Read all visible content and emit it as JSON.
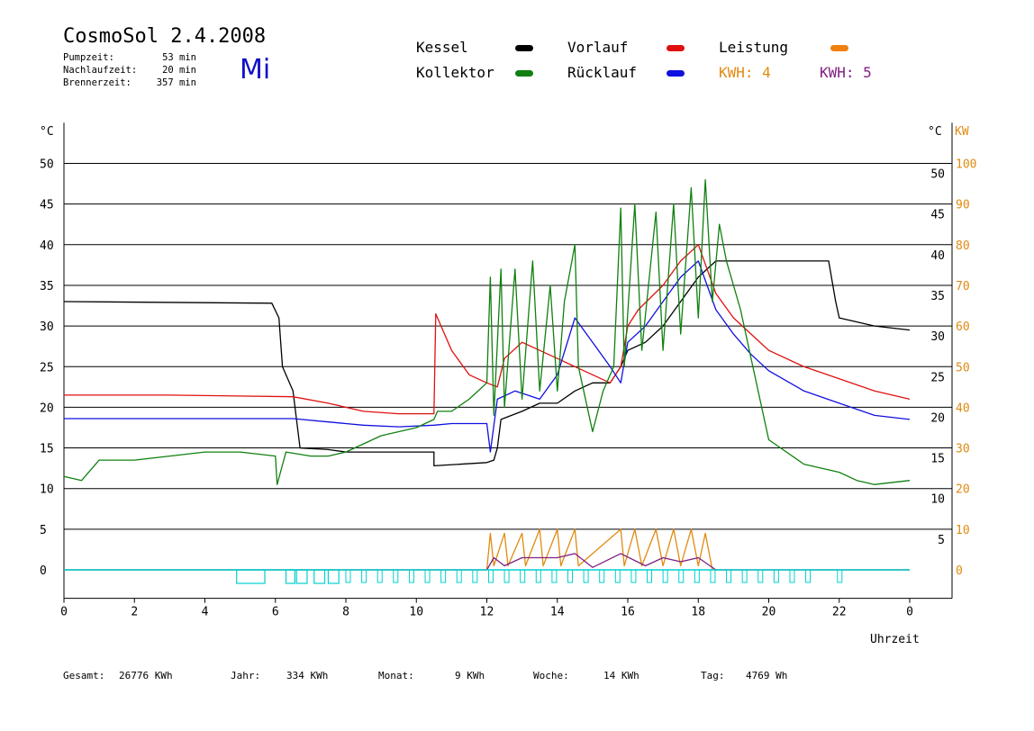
{
  "header": {
    "title": "CosmoSol 2.4.2008",
    "weekday": "Mi",
    "stats": [
      {
        "label": "Pumpzeit:",
        "value": "53 min"
      },
      {
        "label": "Nachlaufzeit:",
        "value": "20 min"
      },
      {
        "label": "Brennerzeit:",
        "value": "357 min"
      }
    ]
  },
  "legend": {
    "items": [
      {
        "name": "Kessel",
        "color": "#000000"
      },
      {
        "name": "Vorlauf",
        "color": "#e01010"
      },
      {
        "name": "Leistung",
        "color": "#f08010"
      },
      {
        "name": "Kollektor",
        "color": "#108010"
      },
      {
        "name": "Rücklauf",
        "color": "#1010e0"
      }
    ],
    "kwh_orange": "KWH: 4",
    "kwh_purple": "KWH: 5",
    "kwh_orange_color": "#e08a10",
    "kwh_purple_color": "#802080"
  },
  "footer": [
    {
      "label": "Gesamt:",
      "value": "26776 KWh"
    },
    {
      "label": "Jahr:",
      "value": "334 KWh"
    },
    {
      "label": "Monat:",
      "value": "9 KWh"
    },
    {
      "label": "Woche:",
      "value": "14 KWh"
    },
    {
      "label": "Tag:",
      "value": "4769 Wh"
    }
  ],
  "chart_data": {
    "type": "line",
    "xlabel": "Uhrzeit",
    "y_left_unit": "°C",
    "y_right_unit": "°C",
    "y2_unit": "KW",
    "x_ticks": [
      "0",
      "2",
      "4",
      "6",
      "8",
      "10",
      "12",
      "14",
      "16",
      "18",
      "20",
      "22",
      "0"
    ],
    "y_left_ticks": [
      0,
      5,
      10,
      15,
      20,
      25,
      30,
      35,
      40,
      45,
      50
    ],
    "y_right_ticks": [
      5,
      10,
      15,
      20,
      25,
      30,
      35,
      40,
      45,
      50
    ],
    "y2_ticks": [
      0,
      10,
      20,
      30,
      40,
      50,
      60,
      70,
      80,
      90,
      100
    ],
    "xlim": [
      0,
      24
    ],
    "ylim": [
      -3.5,
      55
    ],
    "grid": true,
    "series": [
      {
        "name": "Kessel",
        "color": "#000000",
        "points": [
          [
            0,
            33
          ],
          [
            5.9,
            32.8
          ],
          [
            6.1,
            31
          ],
          [
            6.2,
            25
          ],
          [
            6.5,
            22
          ],
          [
            6.7,
            15
          ],
          [
            7.5,
            14.8
          ],
          [
            8,
            14.5
          ],
          [
            10.5,
            14.5
          ],
          [
            10.5,
            12.8
          ],
          [
            12,
            13.2
          ],
          [
            12.2,
            13.5
          ],
          [
            12.3,
            15
          ],
          [
            12.4,
            18.5
          ],
          [
            13,
            19.5
          ],
          [
            13.5,
            20.5
          ],
          [
            14,
            20.5
          ],
          [
            14.5,
            22
          ],
          [
            15,
            23
          ],
          [
            15.5,
            23
          ],
          [
            15.8,
            25
          ],
          [
            16,
            27
          ],
          [
            16.5,
            28
          ],
          [
            17,
            30
          ],
          [
            17.5,
            33
          ],
          [
            18,
            36
          ],
          [
            18.5,
            38
          ],
          [
            19,
            38
          ],
          [
            20,
            38
          ],
          [
            21,
            38
          ],
          [
            21.7,
            38
          ],
          [
            21.9,
            33
          ],
          [
            22,
            31
          ],
          [
            23,
            30
          ],
          [
            24,
            29.5
          ]
        ]
      },
      {
        "name": "Vorlauf",
        "color": "#e01010",
        "points": [
          [
            0,
            21.5
          ],
          [
            3,
            21.5
          ],
          [
            6.5,
            21.3
          ],
          [
            7.5,
            20.5
          ],
          [
            8.5,
            19.5
          ],
          [
            9.5,
            19.2
          ],
          [
            10.5,
            19.2
          ],
          [
            10.55,
            31.5
          ],
          [
            11,
            27
          ],
          [
            11.5,
            24
          ],
          [
            12,
            23
          ],
          [
            12.3,
            22.5
          ],
          [
            12.5,
            26
          ],
          [
            13,
            28
          ],
          [
            13.5,
            27
          ],
          [
            14,
            26
          ],
          [
            14.5,
            25
          ],
          [
            15,
            24
          ],
          [
            15.5,
            23
          ],
          [
            15.8,
            25
          ],
          [
            16,
            30
          ],
          [
            16.3,
            32
          ],
          [
            17,
            35
          ],
          [
            17.5,
            38
          ],
          [
            18,
            40
          ],
          [
            18.5,
            34
          ],
          [
            19,
            31
          ],
          [
            19.5,
            29
          ],
          [
            20,
            27
          ],
          [
            21,
            25
          ],
          [
            22,
            23.5
          ],
          [
            23,
            22
          ],
          [
            24,
            21
          ]
        ]
      },
      {
        "name": "Rücklauf",
        "color": "#1010e0",
        "points": [
          [
            0,
            18.6
          ],
          [
            3,
            18.6
          ],
          [
            6.5,
            18.6
          ],
          [
            7.5,
            18.2
          ],
          [
            8.5,
            17.8
          ],
          [
            9.5,
            17.6
          ],
          [
            10.5,
            17.8
          ],
          [
            11,
            18
          ],
          [
            12,
            18
          ],
          [
            12.1,
            14.5
          ],
          [
            12.3,
            21
          ],
          [
            12.8,
            22
          ],
          [
            13.5,
            21
          ],
          [
            14,
            24
          ],
          [
            14.5,
            31
          ],
          [
            15,
            28
          ],
          [
            15.5,
            25
          ],
          [
            15.8,
            23
          ],
          [
            16,
            28
          ],
          [
            16.5,
            30
          ],
          [
            17,
            33
          ],
          [
            17.5,
            36
          ],
          [
            18,
            38
          ],
          [
            18.5,
            32
          ],
          [
            19,
            29
          ],
          [
            19.5,
            26.5
          ],
          [
            20,
            24.5
          ],
          [
            21,
            22
          ],
          [
            22,
            20.5
          ],
          [
            23,
            19
          ],
          [
            24,
            18.5
          ]
        ]
      },
      {
        "name": "Kollektor",
        "color": "#108010",
        "points": [
          [
            0,
            11.5
          ],
          [
            0.5,
            11
          ],
          [
            1,
            13.5
          ],
          [
            2,
            13.5
          ],
          [
            3,
            14
          ],
          [
            4,
            14.5
          ],
          [
            5,
            14.5
          ],
          [
            6,
            14
          ],
          [
            6.05,
            10.5
          ],
          [
            6.3,
            14.5
          ],
          [
            7,
            14
          ],
          [
            7.5,
            14
          ],
          [
            8,
            14.5
          ],
          [
            9,
            16.5
          ],
          [
            10,
            17.5
          ],
          [
            10.5,
            18.5
          ],
          [
            10.6,
            19.5
          ],
          [
            11,
            19.5
          ],
          [
            11.5,
            21
          ],
          [
            12,
            23
          ],
          [
            12.1,
            36
          ],
          [
            12.2,
            19
          ],
          [
            12.4,
            37
          ],
          [
            12.5,
            20
          ],
          [
            12.8,
            37
          ],
          [
            13,
            21
          ],
          [
            13.3,
            38
          ],
          [
            13.5,
            22
          ],
          [
            13.8,
            35
          ],
          [
            14,
            22
          ],
          [
            14.2,
            33
          ],
          [
            14.5,
            40
          ],
          [
            14.6,
            25
          ],
          [
            15,
            17
          ],
          [
            15.3,
            22
          ],
          [
            15.6,
            25
          ],
          [
            15.8,
            44.5
          ],
          [
            15.9,
            25
          ],
          [
            16.2,
            45
          ],
          [
            16.4,
            27
          ],
          [
            16.8,
            44
          ],
          [
            17,
            27
          ],
          [
            17.3,
            45
          ],
          [
            17.5,
            29
          ],
          [
            17.8,
            47
          ],
          [
            18,
            31
          ],
          [
            18.2,
            48
          ],
          [
            18.4,
            33
          ],
          [
            18.6,
            42.5
          ],
          [
            18.8,
            38
          ],
          [
            19.2,
            32
          ],
          [
            19.5,
            26
          ],
          [
            20,
            16
          ],
          [
            21,
            13
          ],
          [
            22,
            12
          ],
          [
            22.5,
            11
          ],
          [
            23,
            10.5
          ],
          [
            24,
            11
          ]
        ]
      },
      {
        "name": "Leistung",
        "color": "#e08a10",
        "points": [
          [
            0,
            0
          ],
          [
            12,
            0
          ],
          [
            12.1,
            4.5
          ],
          [
            12.2,
            0.5
          ],
          [
            12.5,
            4.5
          ],
          [
            12.6,
            0.5
          ],
          [
            13,
            4.5
          ],
          [
            13.1,
            0.5
          ],
          [
            13.5,
            5
          ],
          [
            13.6,
            0.5
          ],
          [
            14,
            5
          ],
          [
            14.1,
            0.5
          ],
          [
            14.5,
            5
          ],
          [
            14.6,
            0.5
          ],
          [
            15.8,
            5
          ],
          [
            15.9,
            0.5
          ],
          [
            16.2,
            5
          ],
          [
            16.4,
            0.5
          ],
          [
            16.8,
            5
          ],
          [
            17,
            0.5
          ],
          [
            17.3,
            5
          ],
          [
            17.5,
            0.5
          ],
          [
            17.8,
            5
          ],
          [
            18,
            0.5
          ],
          [
            18.2,
            4.5
          ],
          [
            18.4,
            0
          ],
          [
            24,
            0
          ]
        ]
      },
      {
        "name": "KWH",
        "color": "#802080",
        "points": [
          [
            0,
            0
          ],
          [
            12,
            0
          ],
          [
            12.2,
            1.5
          ],
          [
            12.5,
            0.5
          ],
          [
            13,
            1.5
          ],
          [
            13.5,
            1.5
          ],
          [
            14,
            1.5
          ],
          [
            14.5,
            2
          ],
          [
            15,
            0.3
          ],
          [
            15.8,
            2
          ],
          [
            16.5,
            0.5
          ],
          [
            17,
            1.5
          ],
          [
            17.5,
            1
          ],
          [
            18,
            1.5
          ],
          [
            18.5,
            0
          ],
          [
            24,
            0
          ]
        ]
      }
    ],
    "pump_status_color": "#00d0d0"
  }
}
